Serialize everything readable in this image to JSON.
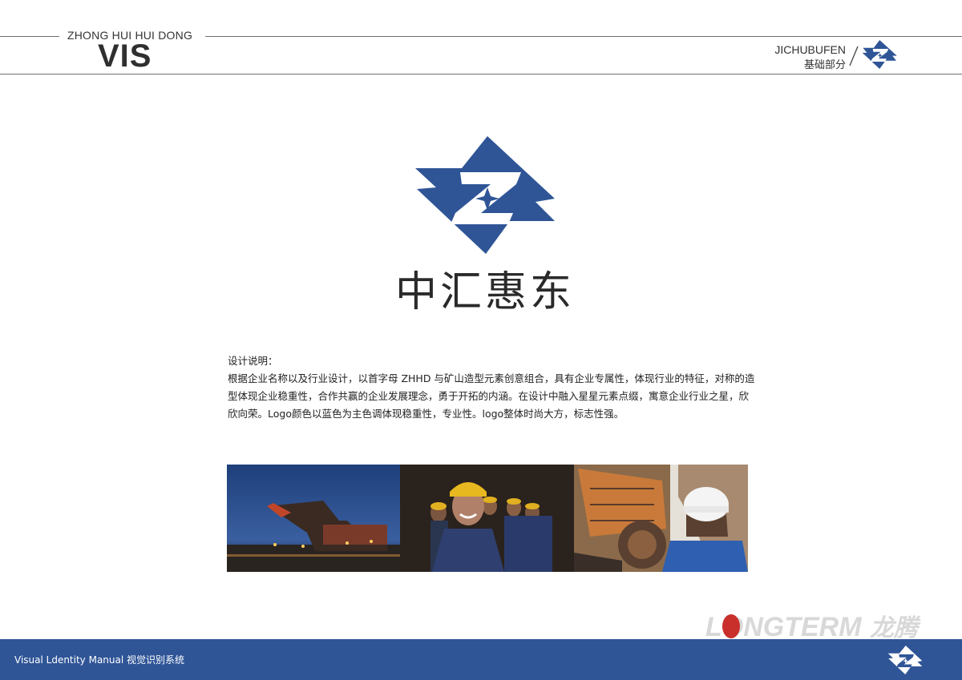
{
  "header": {
    "brand_sub": "ZHONG HUI HUI DONG",
    "brand_title": "VIS",
    "section_en": "JICHUBUFEN",
    "section_cn": "基础部分"
  },
  "logo": {
    "name": "中汇惠东",
    "brand_color": "#2f5597"
  },
  "description": {
    "title": "设计说明：",
    "body": "根据企业名称以及行业设计，以首字母 ZHHD 与矿山造型元素创意组合，具有企业专属性，体现行业的特征，对称的造型体现企业稳重性，合作共赢的企业发展理念，勇于开拓的内涵。在设计中融入星星元素点缀，寓意企业行业之星，欣欣向荣。Logo颜色以蓝色为主色调体现稳重性，专业性。logo整体时尚大方，标志性强。"
  },
  "photos": [
    {
      "icon": "mining-excavator-dusk-photo"
    },
    {
      "icon": "miners-with-helmets-photo"
    },
    {
      "icon": "bucket-wheel-excavator-worker-photo"
    }
  ],
  "watermark": {
    "text": "LONGTERM",
    "cn": "龙腾",
    "color": "#d8d8d8",
    "accent": "#c9302c"
  },
  "footer": {
    "text": "Visual Ldentity Manual  视觉识别系统",
    "background": "#2f5597"
  }
}
